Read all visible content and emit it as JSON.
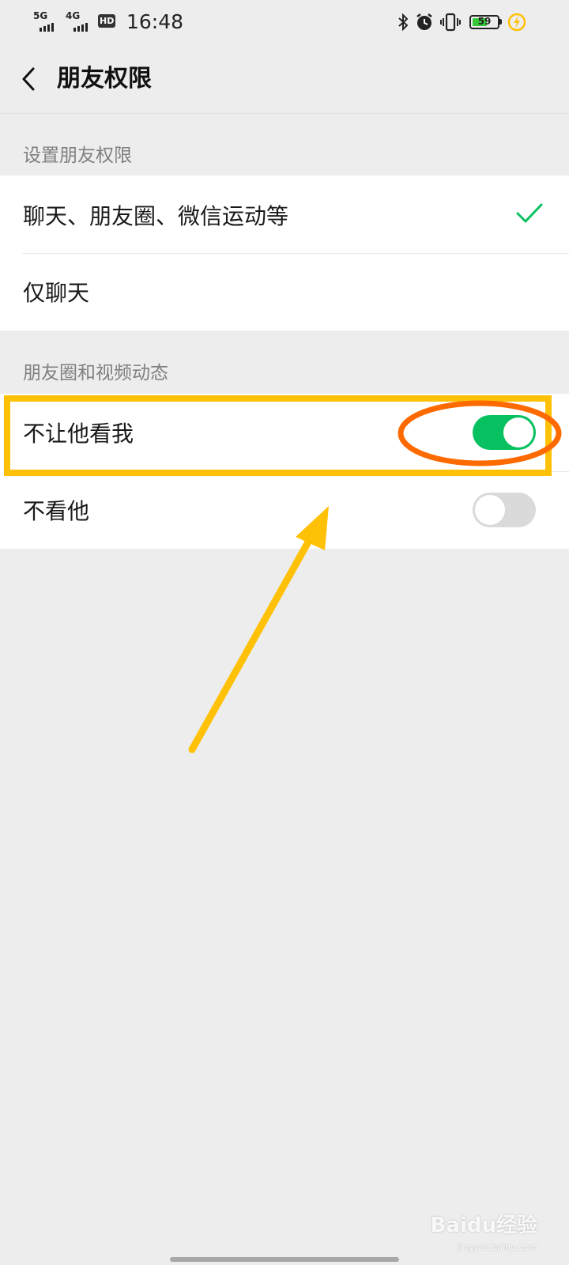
{
  "status_bar": {
    "net1": "5G",
    "net2": "4G",
    "hd": "HD",
    "time": "16:48",
    "battery_level": "59",
    "icons": [
      "bluetooth-icon",
      "alarm-icon",
      "vibrate-icon",
      "battery-icon",
      "charging-icon"
    ]
  },
  "header": {
    "title": "朋友权限",
    "back_icon": "back-arrow-icon"
  },
  "permission_section": {
    "label": "设置朋友权限",
    "options": [
      {
        "label": "聊天、朋友圈、微信运动等",
        "selected": true
      },
      {
        "label": "仅聊天",
        "selected": false
      }
    ]
  },
  "moments_section": {
    "label": "朋友圈和视频动态",
    "toggles": [
      {
        "label": "不让他看我",
        "on": true
      },
      {
        "label": "不看他",
        "on": false
      }
    ]
  },
  "colors": {
    "accent_green": "#07c160",
    "annotation_yellow": "#ffc106",
    "annotation_orange": "#ff6a00"
  },
  "watermark": {
    "text": "Baidu经验",
    "sub": "jingyan.baidu.com"
  }
}
